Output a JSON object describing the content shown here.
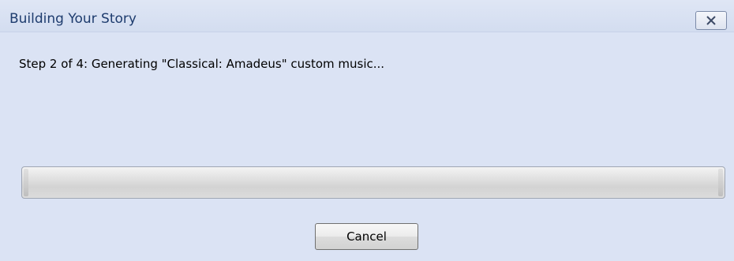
{
  "dialog": {
    "title": "Building Your Story",
    "close_icon": "close-x-icon",
    "step_message": "Step 2 of 4: Generating \"Classical: Amadeus\" custom music...",
    "progress": 0.0,
    "cancel_label": "Cancel"
  },
  "colors": {
    "background": "#dbe3f4",
    "title_text": "#1e3c6e",
    "progress_track": "#d3d3d3"
  }
}
